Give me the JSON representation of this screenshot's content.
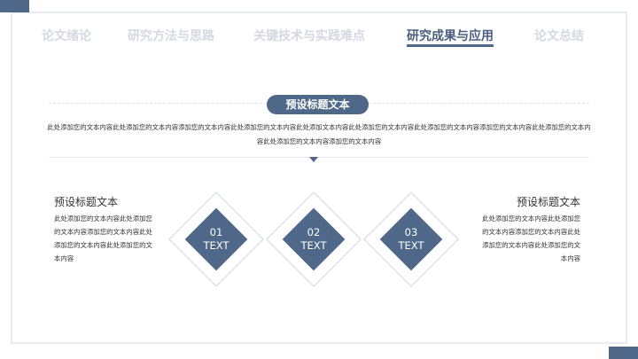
{
  "nav": {
    "items": [
      {
        "label": "论文绪论",
        "active": false
      },
      {
        "label": "研究方法与思路",
        "active": false
      },
      {
        "label": "关键技术与实践难点",
        "active": false
      },
      {
        "label": "研究成果与应用",
        "active": true
      },
      {
        "label": "论文总结",
        "active": false
      }
    ]
  },
  "section": {
    "title": "预设标题文本",
    "description": "此处添加您的文本内容此处添加您的文本内容添加您的文本内容此处添加您的文本内容此处添加文本内容此处添加您的文本内容此处添加您的文本内容添加您的文本内容此处添加您的文本内容此处添加您的文本内容添加您的文本内容"
  },
  "left_block": {
    "title": "预设标题文本",
    "body": "此处添加您的文本内容此处添加您的文本内容添加您的文本内容此处添加您的文本内容此处添加您的文本内容"
  },
  "right_block": {
    "title": "预设标题文本",
    "body": "此处添加您的文本内容此处添加您的文本内容添加您的文本内容此处添加您的文本内容此处添加您的文本内容"
  },
  "steps": [
    {
      "num": "01",
      "text": "TEXT"
    },
    {
      "num": "02",
      "text": "TEXT"
    },
    {
      "num": "03",
      "text": "TEXT"
    }
  ],
  "colors": {
    "accent": "#4f6889",
    "inactive_nav": "#d4d9e1"
  }
}
